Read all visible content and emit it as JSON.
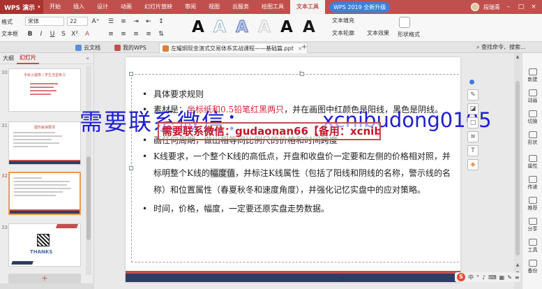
{
  "colors": {
    "accent": "#c0504d",
    "brand_dark": "#2e3d66",
    "watermark_blue": "#1f1fd1",
    "watermark_red": "#c4142a"
  },
  "menubar": {
    "app_name": "WPS 演示",
    "items": [
      "开始",
      "插入",
      "设计",
      "动画",
      "幻灯片放映",
      "审阅",
      "视图",
      "云服务",
      "绘图工具",
      "文本工具"
    ],
    "promo": "WPS 2019 全新升级",
    "user_name": "段瑞青"
  },
  "ribbon": {
    "font_name": "宋体",
    "font_size": "22",
    "left_label_top": "格式",
    "left_label_bottom": "文本框",
    "text_fill": "文本填充",
    "text_outline": "文本轮廓",
    "text_effect": "文本效果",
    "shape_style": "形状格式"
  },
  "tabs": {
    "items": [
      "云文档",
      "我的WPS",
      "左耀炯现金演式交易体系实战课程——基础篇.ppt"
    ],
    "search_cmd": "查找命令、搜索..."
  },
  "left_pane": {
    "tab_outline": "大纲",
    "tab_slides": "幻灯片",
    "slide_numbers": [
      "30",
      "31",
      "32",
      "33"
    ],
    "thumb_titles": [
      "手绘火腿表 / 学生当堂练习",
      "图形解读要求",
      "",
      ""
    ],
    "thanks_text": "THANKS"
  },
  "slide": {
    "bullets": [
      {
        "pre": "具体要求规则",
        "red": "",
        "post": ""
      },
      {
        "pre": "素材是：",
        "red": "坐标纸和0.5铅笔红黑两只",
        "post": "，并在画图中红颜色是阳线，黑色是阴线。"
      },
      {
        "pre": "",
        "red": "",
        "post": ""
      },
      {
        "pre": "画任何周期，做出相等同比例尺的价格和时间跨度",
        "red": "",
        "post": ""
      },
      {
        "pre": "K线要求，一个整个K线的高低点，开盘和收盘价一定要和左侧的价格相对照，并标明整个K线的",
        "hl": "幅度值",
        "post": "，并标注K线属性（包括了阳线和阴线的名称，警示线的名称）和位置属性（春夏秋冬和速度角度），并强化记忆实盘中的应对策略。"
      },
      {
        "pre": "时间，价格，幅度，一定要还原实盘走势数据。",
        "red": "",
        "post": ""
      }
    ],
    "watermark_big_left": "需要联系微信：",
    "watermark_big_right": "xcnibudong0105",
    "watermark_banner": "需要联系微信：gudaonan66【备用：xcnibudong0105】"
  },
  "task_pane": {
    "items": [
      "新建",
      "动画",
      "切换",
      "形状",
      "属性",
      "传递",
      "推荐",
      "分享",
      "工具",
      "备份"
    ]
  },
  "tray": {
    "s_label": "S",
    "icons": [
      "中",
      "°",
      "♪",
      "⌨",
      "▦",
      "✎",
      "≡"
    ]
  }
}
